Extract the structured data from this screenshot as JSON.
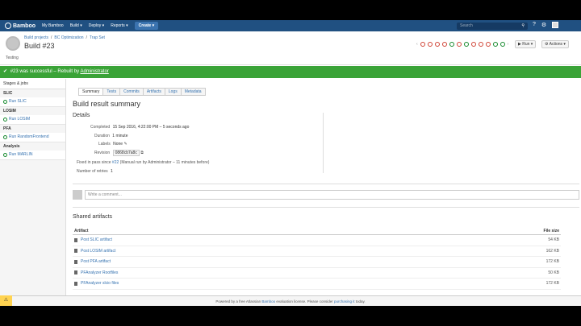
{
  "topnav": {
    "logo": "Bamboo",
    "items": [
      {
        "label": "My Bamboo"
      },
      {
        "label": "Build"
      },
      {
        "label": "Deploy"
      },
      {
        "label": "Reports"
      }
    ],
    "create_label": "Create",
    "search_placeholder": "Search",
    "help_glyph": "?",
    "settings_glyph": "⚙"
  },
  "header": {
    "breadcrumb": [
      "Build projects",
      "BC Optimization",
      "Trap Set"
    ],
    "title": "Build #23",
    "subtitle": "Testing",
    "run_label": "Run",
    "actions_label": "Actions"
  },
  "banner": {
    "text": "#23 was successful – Rebuilt by",
    "user": "Administrator"
  },
  "sidebar": {
    "header": "Stages & jobs",
    "stages": [
      {
        "name": "SLIC",
        "job": "Run SLIC"
      },
      {
        "name": "LOSIM",
        "job": "Run LOSIM"
      },
      {
        "name": "PFA",
        "job": "Run RandomFrontend"
      },
      {
        "name": "Analysis",
        "job": "Run MARLIN"
      }
    ]
  },
  "tabs": [
    "Summary",
    "Tests",
    "Commits",
    "Artifacts",
    "Logs",
    "Metadata"
  ],
  "main": {
    "title": "Build result summary",
    "details_title": "Details",
    "completed_label": "Completed",
    "completed_value": "15 Sep 2016, 4:22:00 PM – 5 seconds ago",
    "duration_label": "Duration",
    "duration_value": "1 minute",
    "labels_label": "Labels",
    "labels_value": "None",
    "revision_label": "Revision",
    "revision_value": "0868cb7a8c",
    "fixed_text": "Fixed in pass since",
    "fixed_link": "#22",
    "fixed_suffix": "(Manual run by Administrator – 11 minutes before)",
    "retries_label": "Number of retries",
    "retries_value": "1",
    "comment_placeholder": "Write a comment..."
  },
  "artifacts": {
    "title": "Shared artifacts",
    "col_artifact": "Artifact",
    "col_size": "File size",
    "rows": [
      {
        "name": "Post SLIC artifact",
        "size": "54 KB"
      },
      {
        "name": "Post LOSIM artifact",
        "size": "162 KB"
      },
      {
        "name": "Post PFA artifact",
        "size": "172 KB"
      },
      {
        "name": "PFAnalyzer Rootfiles",
        "size": "50 KB"
      },
      {
        "name": "PFAnalyzer slcio files",
        "size": "172 KB"
      }
    ]
  },
  "footer": {
    "prefix": "Powered by a free Atlassian",
    "product": "Bamboo",
    "middle": "evaluation license. Please consider",
    "link": "purchasing it",
    "suffix": "today."
  },
  "colors": {
    "nav": "#205081",
    "success": "#3aa337",
    "link": "#3572b0"
  }
}
